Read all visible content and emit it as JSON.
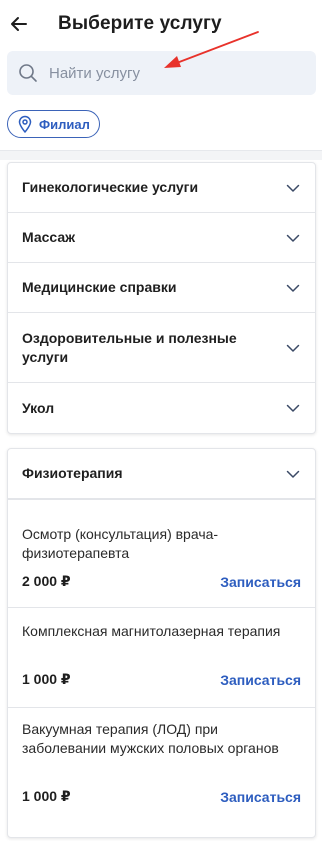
{
  "header": {
    "title": "Выберите услугу"
  },
  "search": {
    "placeholder": "Найти услугу"
  },
  "filter_chip": {
    "label": "Филиал"
  },
  "categories": [
    {
      "label": "Гинекологические услуги"
    },
    {
      "label": "Массаж"
    },
    {
      "label": "Медицинские справки"
    },
    {
      "label": "Оздоровительные и полезные услуги"
    },
    {
      "label": "Укол"
    }
  ],
  "expanded_category": {
    "label": "Физиотерапия",
    "services": [
      {
        "name": "Осмотр (консультация) врача-физиотерапевта",
        "price": "2 000 ₽",
        "action": "Записаться"
      },
      {
        "name": "Комплексная магнитолазерная терапия",
        "price": "1 000 ₽",
        "action": "Записаться"
      },
      {
        "name": "Вакуумная терапия (ЛОД) при заболевании мужских половых органов",
        "price": "1 000 ₽",
        "action": "Записаться"
      }
    ]
  },
  "colors": {
    "accent": "#2d5dbf",
    "search_bg": "#eef2f8",
    "annotation_arrow": "#e8322b"
  }
}
